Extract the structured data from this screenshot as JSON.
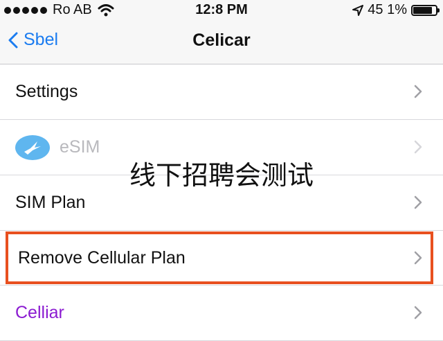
{
  "status_bar": {
    "carrier": "Ro AB",
    "time": "12:8 PM",
    "battery": "45 1%",
    "battery_level": 0.85
  },
  "nav": {
    "back_label": "Sbel",
    "title": "Celicar"
  },
  "rows": [
    {
      "label": "Settings",
      "icon": "chevron-right-icon"
    },
    {
      "label": "eSIM",
      "icon": "esim-bird-icon",
      "disabled": true
    },
    {
      "label": "SIM Plan",
      "icon": "chevron-right-icon"
    },
    {
      "label": "Remove Cellular Plan",
      "icon": "chevron-right-icon",
      "highlighted": true
    },
    {
      "label": "Celliar",
      "icon": "chevron-right-icon"
    }
  ],
  "watermark": "线下招聘会测试",
  "colors": {
    "accent": "#1b7cf0",
    "highlight": "#e8501f",
    "celliar_text": "#8b1bd1",
    "esim_icon": "#5fb6ef"
  }
}
